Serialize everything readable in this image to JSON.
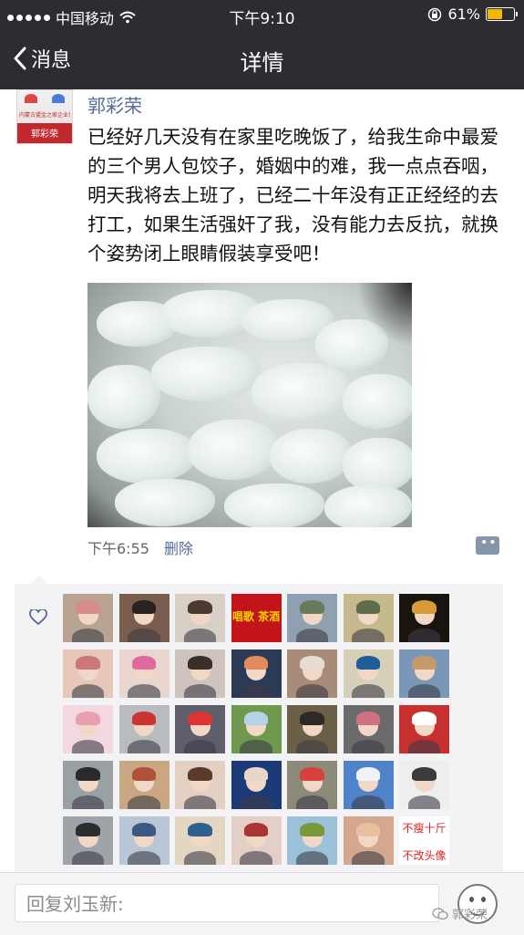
{
  "status_bar": {
    "carrier": "中国移动",
    "time": "下午9:10",
    "battery": "61%",
    "battery_level": 0.61
  },
  "nav": {
    "back_label": "消息",
    "title": "详情"
  },
  "post": {
    "author": "郭彩荣",
    "avatar_caption": "郭彩荣",
    "avatar_small_text": "内蒙古盟金之家企业协会",
    "text": "已经好几天没有在家里吃晚饭了，给我生命中最爱的三个男人包饺子，婚姻中的难，我一点点吞咽，明天我将去上班了，已经二十年没有正正经经的去打工，如果生活强奸了我，没有能力去反抗，就换个姿势闭上眼睛假装享受吧！",
    "time": "下午6:55",
    "delete_label": "删除"
  },
  "likes": {
    "avatars": [
      {
        "bg": "#b9a393",
        "accent": "#d98c8c"
      },
      {
        "bg": "#7a5d4c",
        "accent": "#2b2320"
      },
      {
        "bg": "#d8cfc6",
        "accent": "#4b3a30"
      },
      {
        "bg": "#c4141b",
        "accent": "#f3d000",
        "caption": "唱歌 茶酒"
      },
      {
        "bg": "#8fa0b0",
        "accent": "#6b7b5a"
      },
      {
        "bg": "#c7b98e",
        "accent": "#5f6d4b"
      },
      {
        "bg": "#1a140f",
        "accent": "#d99a3a"
      },
      {
        "bg": "#e6c7b9",
        "accent": "#c77"
      },
      {
        "bg": "#e9d6cf",
        "accent": "#e06aa0"
      },
      {
        "bg": "#cfc4bd",
        "accent": "#3b2f2a"
      },
      {
        "bg": "#2b3a55",
        "accent": "#e08b5c"
      },
      {
        "bg": "#a88b78",
        "accent": "#e5ddd2"
      },
      {
        "bg": "#d7d0b8",
        "accent": "#1f5e9b"
      },
      {
        "bg": "#7b97b8",
        "accent": "#c59a6a"
      },
      {
        "bg": "#f3d8e0",
        "accent": "#e8a0b0"
      },
      {
        "bg": "#b9bcbf",
        "accent": "#c33"
      },
      {
        "bg": "#5e5f6a",
        "accent": "#d33"
      },
      {
        "bg": "#6f9a4e",
        "accent": "#b7d2e6"
      },
      {
        "bg": "#6b5f45",
        "accent": "#2d2a25"
      },
      {
        "bg": "#6b6b6b",
        "accent": "#d07080"
      },
      {
        "bg": "#c82f2f",
        "accent": "#ffffff"
      },
      {
        "bg": "#9aa1a6",
        "accent": "#2a2a2a"
      },
      {
        "bg": "#caa783",
        "accent": "#b0513a"
      },
      {
        "bg": "#e4cfc3",
        "accent": "#5a3a2a"
      },
      {
        "bg": "#1c3a78",
        "accent": "#e8d6c8"
      },
      {
        "bg": "#8d8a7a",
        "accent": "#d8413a"
      },
      {
        "bg": "#4f83c9",
        "accent": "#f0f4f8"
      },
      {
        "bg": "#eeeeee",
        "accent": "#3b3b3b"
      },
      {
        "bg": "#9fa4aa",
        "accent": "#2d2d2d"
      },
      {
        "bg": "#b9c6d6",
        "accent": "#3d5a85"
      },
      {
        "bg": "#e3d6c2",
        "accent": "#2f5f8f"
      },
      {
        "bg": "#e3cfc6",
        "accent": "#a33"
      },
      {
        "bg": "#9bc2d8",
        "accent": "#7a9a3a"
      },
      {
        "bg": "#d4a88f",
        "accent": "#e8c0a0"
      },
      {
        "bg": "#ffffff",
        "accent": "#d22",
        "caption_top": "不瘦十斤",
        "caption_bottom": "不改头像"
      }
    ]
  },
  "reply": {
    "placeholder": "回复刘玉新:"
  },
  "watermark": "郭彩荣"
}
